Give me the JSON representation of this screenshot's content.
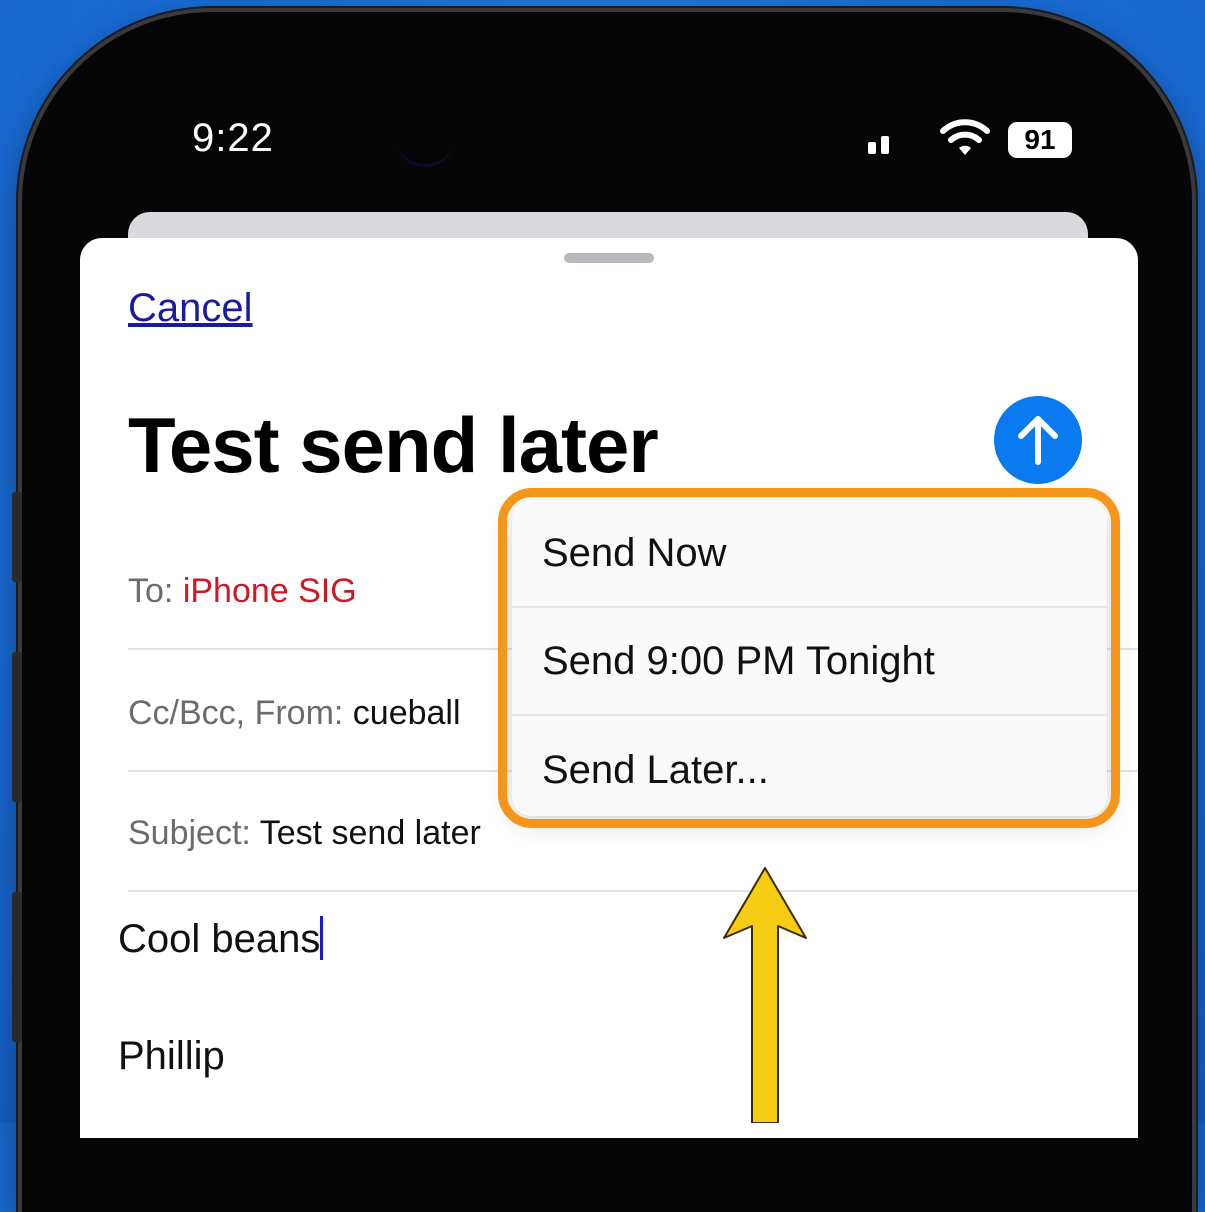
{
  "status_bar": {
    "time": "9:22",
    "battery": "91"
  },
  "compose": {
    "cancel_label": "Cancel",
    "title": "Test send later",
    "to_label": "To:",
    "to_value": "iPhone SIG",
    "ccbcc_label": "Cc/Bcc, From:",
    "from_value": "cueball",
    "subject_label": "Subject:",
    "subject_value": "Test send later",
    "body_lines": [
      "Cool beans",
      "Phillip"
    ]
  },
  "send_menu": {
    "items": [
      "Send Now",
      "Send 9:00 PM Tonight",
      "Send Later..."
    ]
  },
  "colors": {
    "background": "#1a72dc",
    "send_button": "#0a7af0",
    "highlight": "#f5961b",
    "arrow": "#f7cd14",
    "recipient": "#cc1a24"
  },
  "icons": [
    "signal-icon",
    "wifi-icon",
    "battery-icon",
    "send-arrow-icon",
    "pointer-arrow-icon"
  ]
}
